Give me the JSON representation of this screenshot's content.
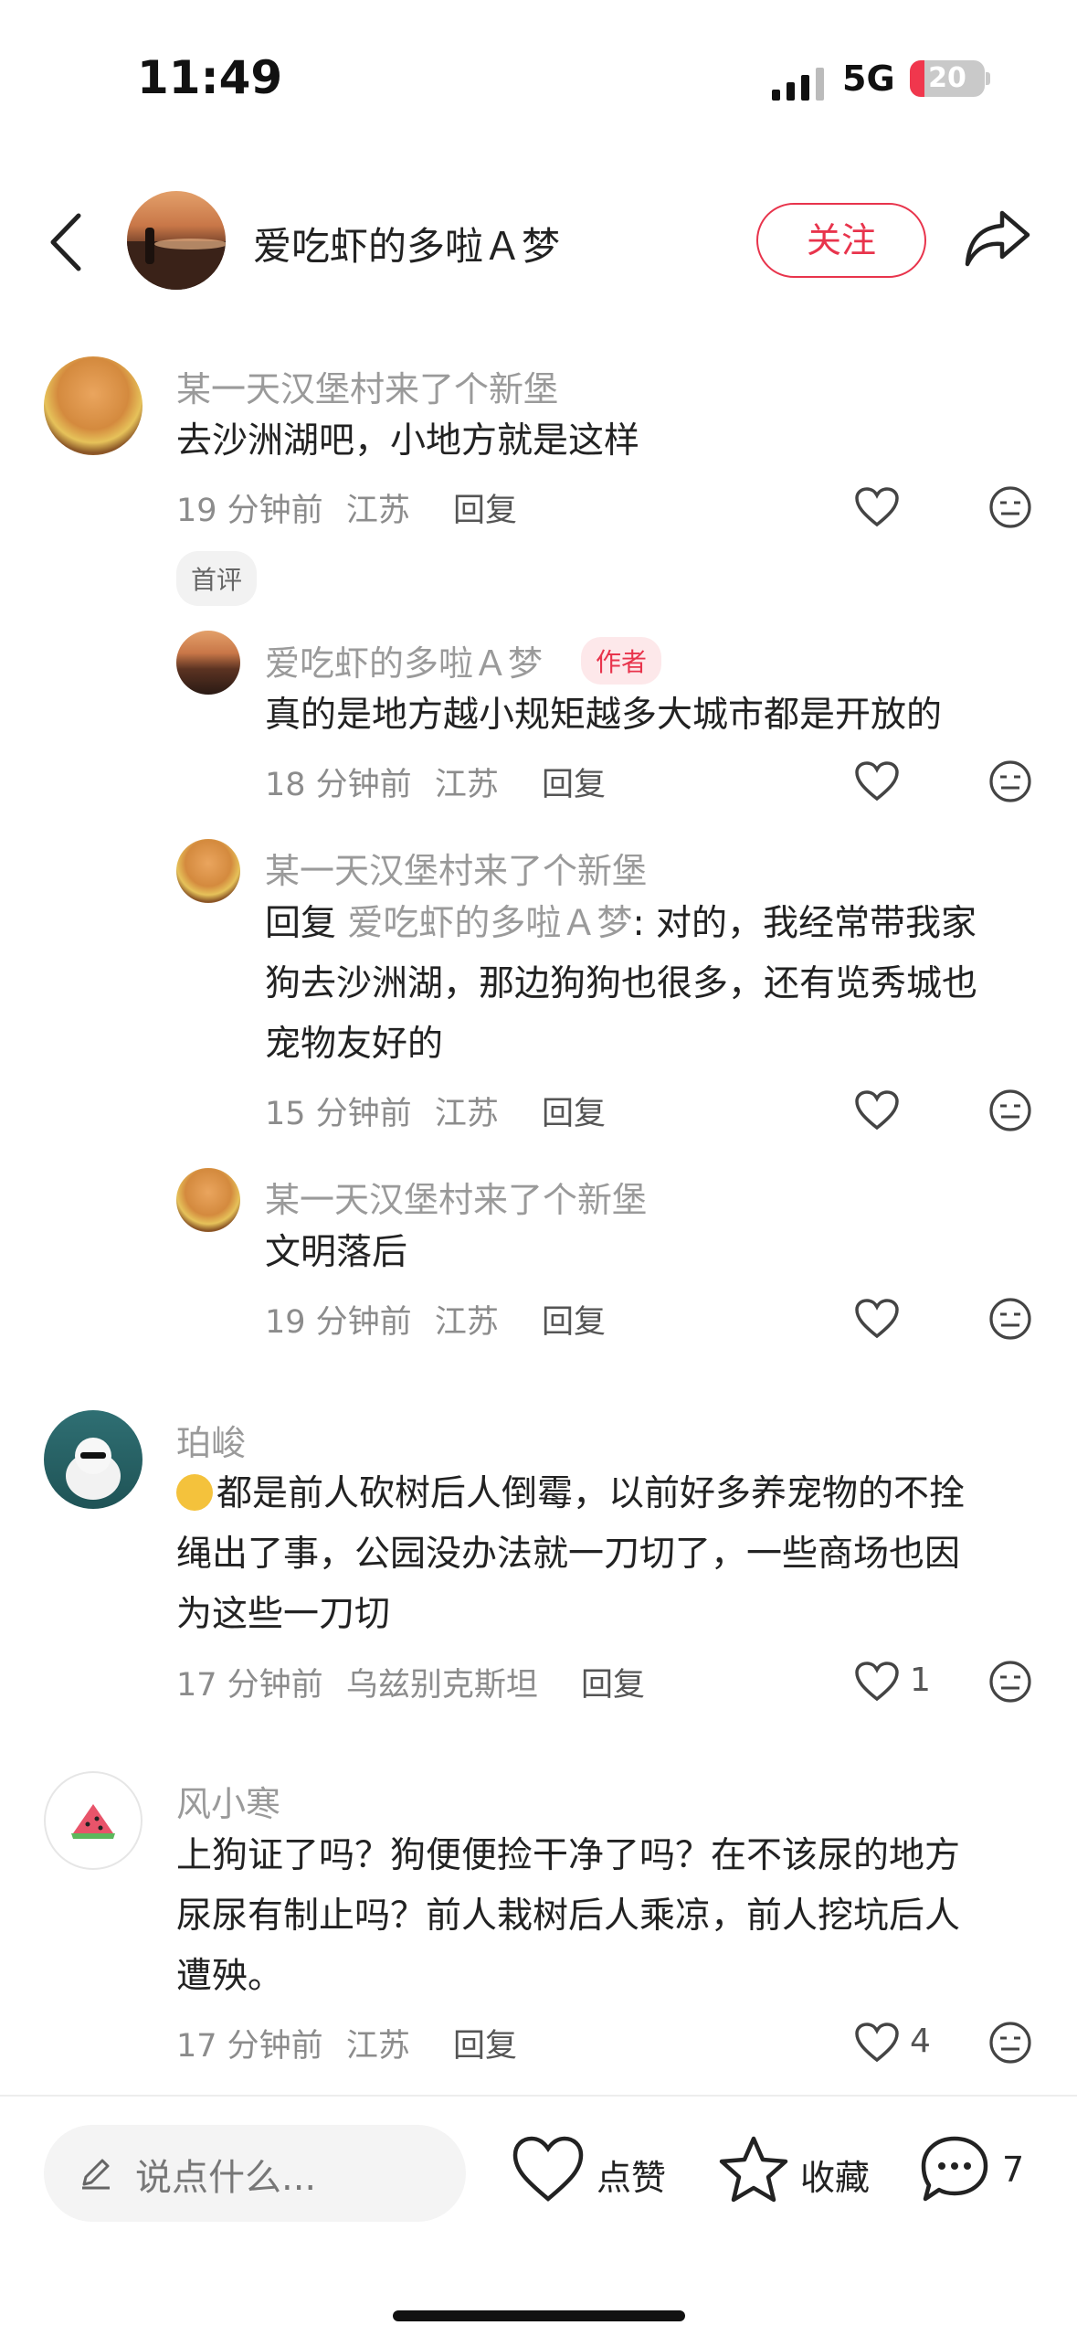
{
  "status_bar": {
    "time": "11:49",
    "network": "5G",
    "battery": "20"
  },
  "header": {
    "title": "爱吃虾的多啦Ａ梦",
    "follow_label": "关注"
  },
  "comments": [
    {
      "user": "某一天汉堡村来了个新堡",
      "text": "去沙洲湖吧，小地方就是这样",
      "time": "19 分钟前",
      "location": "江苏",
      "reply_label": "回复",
      "tag": "首评",
      "replies": [
        {
          "user": "爱吃虾的多啦Ａ梦",
          "author_tag": "作者",
          "text": "真的是地方越小规矩越多大城市都是开放的",
          "time": "18 分钟前",
          "location": "江苏",
          "reply_label": "回复"
        },
        {
          "user": "某一天汉堡村来了个新堡",
          "reply_prefix": "回复",
          "reply_to": "爱吃虾的多啦Ａ梦",
          "text_lines": [
            "对的，我经常带我家",
            "狗去沙洲湖，那边狗狗也很多，还有览秀城也",
            "宠物友好的"
          ],
          "time": "15 分钟前",
          "location": "江苏",
          "reply_label": "回复"
        },
        {
          "user": "某一天汉堡村来了个新堡",
          "text": "文明落后",
          "time": "19 分钟前",
          "location": "江苏",
          "reply_label": "回复"
        }
      ]
    },
    {
      "user": "珀峻",
      "text_lines": [
        "都是前人砍树后人倒霉，以前好多养宠物的不拴",
        "绳出了事，公园没办法就一刀切了，一些商场也因",
        "为这些一刀切"
      ],
      "time": "17 分钟前",
      "location": "乌兹别克斯坦",
      "reply_label": "回复",
      "likes": "1"
    },
    {
      "user": "风小寒",
      "text_lines": [
        "上狗证了吗？狗便便捡干净了吗？在不该尿的地方",
        "尿尿有制止吗？前人栽树后人乘凉，前人挖坑后人",
        "遭殃。"
      ],
      "time": "17 分钟前",
      "location": "江苏",
      "reply_label": "回复",
      "likes": "4"
    }
  ],
  "bottom_bar": {
    "input_placeholder": "说点什么...",
    "like_label": "点赞",
    "collect_label": "收藏",
    "comment_count": "7"
  },
  "colors": {
    "accent": "#e8344c",
    "muted_text": "#9a9a9a",
    "author_tag_bg": "#fde8ea"
  },
  "icons": [
    "back-chevron-icon",
    "share-icon",
    "heart-icon",
    "meh-face-icon",
    "pencil-icon",
    "star-icon",
    "comment-bubble-icon",
    "signal-icon"
  ]
}
